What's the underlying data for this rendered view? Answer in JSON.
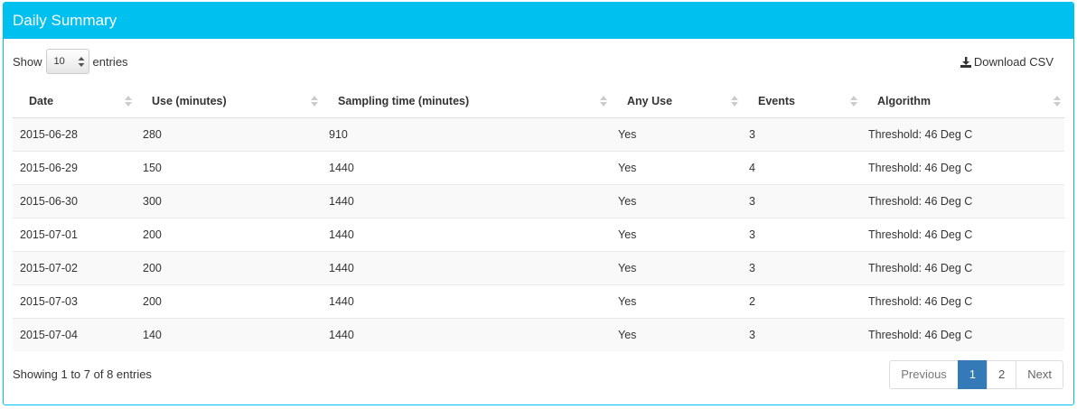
{
  "panel": {
    "title": "Daily Summary"
  },
  "length_control": {
    "show_label": "Show",
    "selected": "10",
    "entries_label": "entries"
  },
  "download": {
    "label": "Download CSV"
  },
  "table": {
    "columns": [
      "Date",
      "Use (minutes)",
      "Sampling time (minutes)",
      "Any Use",
      "Events",
      "Algorithm"
    ],
    "rows": [
      [
        "2015-06-28",
        "280",
        "910",
        "Yes",
        "3",
        "Threshold: 46 Deg C"
      ],
      [
        "2015-06-29",
        "150",
        "1440",
        "Yes",
        "4",
        "Threshold: 46 Deg C"
      ],
      [
        "2015-06-30",
        "300",
        "1440",
        "Yes",
        "3",
        "Threshold: 46 Deg C"
      ],
      [
        "2015-07-01",
        "200",
        "1440",
        "Yes",
        "3",
        "Threshold: 46 Deg C"
      ],
      [
        "2015-07-02",
        "200",
        "1440",
        "Yes",
        "3",
        "Threshold: 46 Deg C"
      ],
      [
        "2015-07-03",
        "200",
        "1440",
        "Yes",
        "2",
        "Threshold: 46 Deg C"
      ],
      [
        "2015-07-04",
        "140",
        "1440",
        "Yes",
        "3",
        "Threshold: 46 Deg C"
      ]
    ]
  },
  "footer": {
    "info": "Showing 1 to 7 of 8 entries"
  },
  "pagination": {
    "previous": "Previous",
    "pages": [
      "1",
      "2"
    ],
    "next": "Next"
  },
  "colors": {
    "header": "#00c0ef",
    "active_page": "#337ab7"
  }
}
